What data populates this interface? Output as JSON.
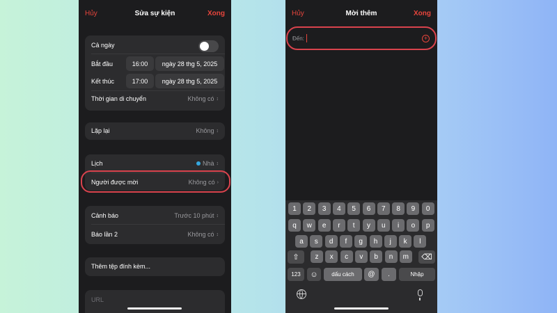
{
  "left_screen": {
    "nav": {
      "cancel": "Hủy",
      "title": "Sửa sự kiện",
      "done": "Xong"
    },
    "all_day": {
      "label": "Cả ngày",
      "on": false
    },
    "start": {
      "label": "Bắt đầu",
      "time": "16:00",
      "date": "ngày 28 thg 5, 2025"
    },
    "end": {
      "label": "Kết thúc",
      "time": "17:00",
      "date": "ngày 28 thg 5, 2025"
    },
    "travel_time": {
      "label": "Thời gian di chuyển",
      "value": "Không có"
    },
    "repeat": {
      "label": "Lặp lại",
      "value": "Không"
    },
    "calendar": {
      "label": "Lịch",
      "value": "Nhà",
      "dot_color": "#35a8e0"
    },
    "invitees": {
      "label": "Người được mời",
      "value": "Không có"
    },
    "alert": {
      "label": "Cảnh báo",
      "value": "Trước 10 phút"
    },
    "second_alert": {
      "label": "Báo lần 2",
      "value": "Không có"
    },
    "attachment": {
      "label": "Thêm tệp đính kèm..."
    },
    "url": {
      "placeholder": "URL"
    }
  },
  "right_screen": {
    "nav": {
      "cancel": "Hủy",
      "title": "Mời thêm",
      "done": "Xong"
    },
    "to_field": {
      "label": "Đến:",
      "value": ""
    },
    "keyboard": {
      "row_numbers": [
        "1",
        "2",
        "3",
        "4",
        "5",
        "6",
        "7",
        "8",
        "9",
        "0"
      ],
      "row1": [
        "q",
        "w",
        "e",
        "r",
        "t",
        "y",
        "u",
        "i",
        "o",
        "p"
      ],
      "row2": [
        "a",
        "s",
        "d",
        "f",
        "g",
        "h",
        "j",
        "k",
        "l"
      ],
      "row3": [
        "z",
        "x",
        "c",
        "v",
        "b",
        "n",
        "m"
      ],
      "numbers_key": "123",
      "space_key": "dấu cách",
      "at_key": "@",
      "dot_key": ".",
      "return_key": "Nhập"
    }
  },
  "colors": {
    "accent": "#e8453c",
    "highlight": "#d9434d",
    "background_dark": "#1c1c1e",
    "cell": "#2c2c2e"
  }
}
